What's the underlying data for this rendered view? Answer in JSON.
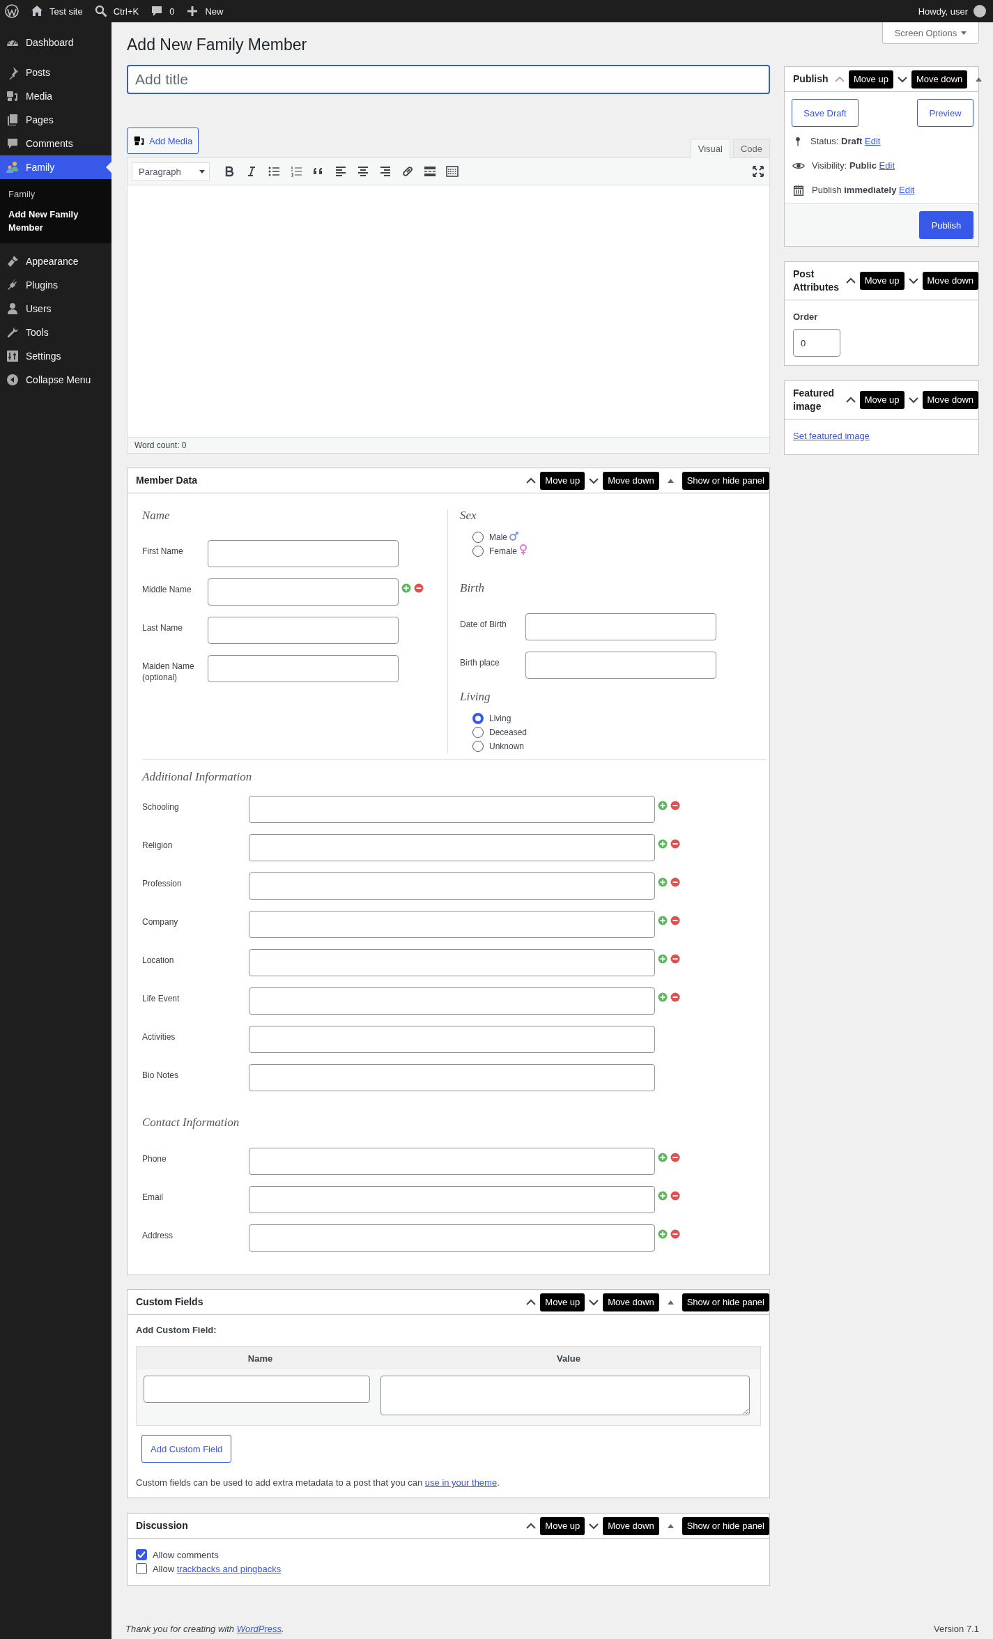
{
  "admin_bar": {
    "site": "Test site",
    "search": "Ctrl+K",
    "comments": "0",
    "new": "New",
    "greeting": "Howdy, user"
  },
  "menu": [
    {
      "label": "Dashboard",
      "selected": false
    },
    {
      "label": "Posts",
      "selected": false
    },
    {
      "label": "Media",
      "selected": false
    },
    {
      "label": "Pages",
      "selected": false
    },
    {
      "label": "Comments",
      "selected": false
    },
    {
      "label": "Family",
      "selected": true,
      "children": [
        {
          "label": "Family",
          "selected": false
        },
        {
          "label": "Add New Family Member",
          "selected": true
        }
      ]
    },
    {
      "label": "Appearance",
      "selected": false
    },
    {
      "label": "Plugins",
      "selected": false
    },
    {
      "label": "Users",
      "selected": false
    },
    {
      "label": "Tools",
      "selected": false
    },
    {
      "label": "Settings",
      "selected": false
    }
  ],
  "collapse": "Collapse Menu",
  "screen_options": "Screen Options",
  "page_title": "Add New Family Member",
  "title_field": {
    "placeholder": "Add title"
  },
  "editor": {
    "add_media": "Add Media",
    "tabs": [
      {
        "label": "Visual",
        "selected": true
      },
      {
        "label": "Code",
        "selected": false
      }
    ],
    "format": "Paragraph",
    "word_count": "Word count: 0"
  },
  "member_data": {
    "title": "Member Data",
    "move_up": "Move up",
    "move_down": "Move down",
    "toggle": "Show or hide panel",
    "up_disabled": false,
    "toggle_arrow": true,
    "name": {
      "heading": "Name",
      "fields": [
        {
          "label": "First Name",
          "repeatable": false
        },
        {
          "label": "Middle Name",
          "repeatable": true
        },
        {
          "label": "Last Name",
          "repeatable": false
        },
        {
          "label": "Maiden Name (optional)",
          "repeatable": false
        }
      ]
    },
    "sex": {
      "heading": "Sex",
      "options": [
        {
          "label": "Male",
          "selected": false
        },
        {
          "label": "Female",
          "selected": false
        }
      ]
    },
    "birth": {
      "heading": "Birth",
      "fields": [
        {
          "label": "Date of Birth"
        },
        {
          "label": "Birth place"
        }
      ]
    },
    "living": {
      "heading": "Living",
      "options": [
        {
          "label": "Living",
          "selected": true
        },
        {
          "label": "Deceased",
          "selected": false
        },
        {
          "label": "Unknown",
          "selected": false
        }
      ]
    },
    "additional": {
      "heading": "Additional Information",
      "fields": [
        {
          "label": "Schooling",
          "repeatable": true
        },
        {
          "label": "Religion",
          "repeatable": true
        },
        {
          "label": "Profession",
          "repeatable": true
        },
        {
          "label": "Company",
          "repeatable": true
        },
        {
          "label": "Location",
          "repeatable": true
        },
        {
          "label": "Life Event",
          "repeatable": true
        },
        {
          "label": "Activities",
          "repeatable": false
        },
        {
          "label": "Bio Notes",
          "repeatable": false
        }
      ]
    },
    "contact": {
      "heading": "Contact Information",
      "fields": [
        {
          "label": "Phone",
          "repeatable": true
        },
        {
          "label": "Email",
          "repeatable": true
        },
        {
          "label": "Address",
          "repeatable": true
        }
      ]
    }
  },
  "custom_fields": {
    "title": "Custom Fields",
    "move_up": "Move up",
    "move_down": "Move down",
    "toggle": "Show or hide panel",
    "up_disabled": false,
    "toggle_arrow": true,
    "heading": "Add Custom Field:",
    "columns": [
      "Name",
      "Value"
    ],
    "button": "Add Custom Field",
    "note": "Custom fields can be used to add extra metadata to a post that you can ",
    "note_link": "use in your theme",
    "note_end": "."
  },
  "discussion": {
    "title": "Discussion",
    "move_up": "Move up",
    "move_down": "Move down",
    "toggle": "Show or hide panel",
    "up_disabled": false,
    "toggle_arrow": true,
    "options": [
      {
        "text": "Allow comments",
        "checked": true
      },
      {
        "text": "Allow ",
        "link": "trackbacks and pingbacks",
        "checked": false
      }
    ]
  },
  "publish": {
    "title": "Publish",
    "move_up": "Move up",
    "move_down": "Move down",
    "up_disabled": true,
    "toggle_arrow": true,
    "save_draft": "Save Draft",
    "preview": "Preview",
    "rows": [
      {
        "label": "Status: ",
        "value": "Draft",
        "link": "Edit"
      },
      {
        "label": "Visibility: ",
        "value": "Public",
        "link": "Edit"
      },
      {
        "label": "Publish ",
        "value": "immediately",
        "link": "Edit"
      }
    ],
    "button": "Publish"
  },
  "post_attributes": {
    "title": "Post Attributes",
    "move_up": "Move up",
    "move_down": "Move down",
    "up_disabled": false,
    "toggle_arrow": false,
    "order_label": "Order",
    "order_value": "0"
  },
  "featured_image": {
    "title": "Featured image",
    "move_up": "Move up",
    "move_down": "Move down",
    "up_disabled": false,
    "toggle_arrow": false,
    "link": "Set featured image"
  },
  "footer": {
    "thanks": "Thank you for creating with ",
    "link": "WordPress",
    "end": ".",
    "version": "Version 7.1"
  }
}
